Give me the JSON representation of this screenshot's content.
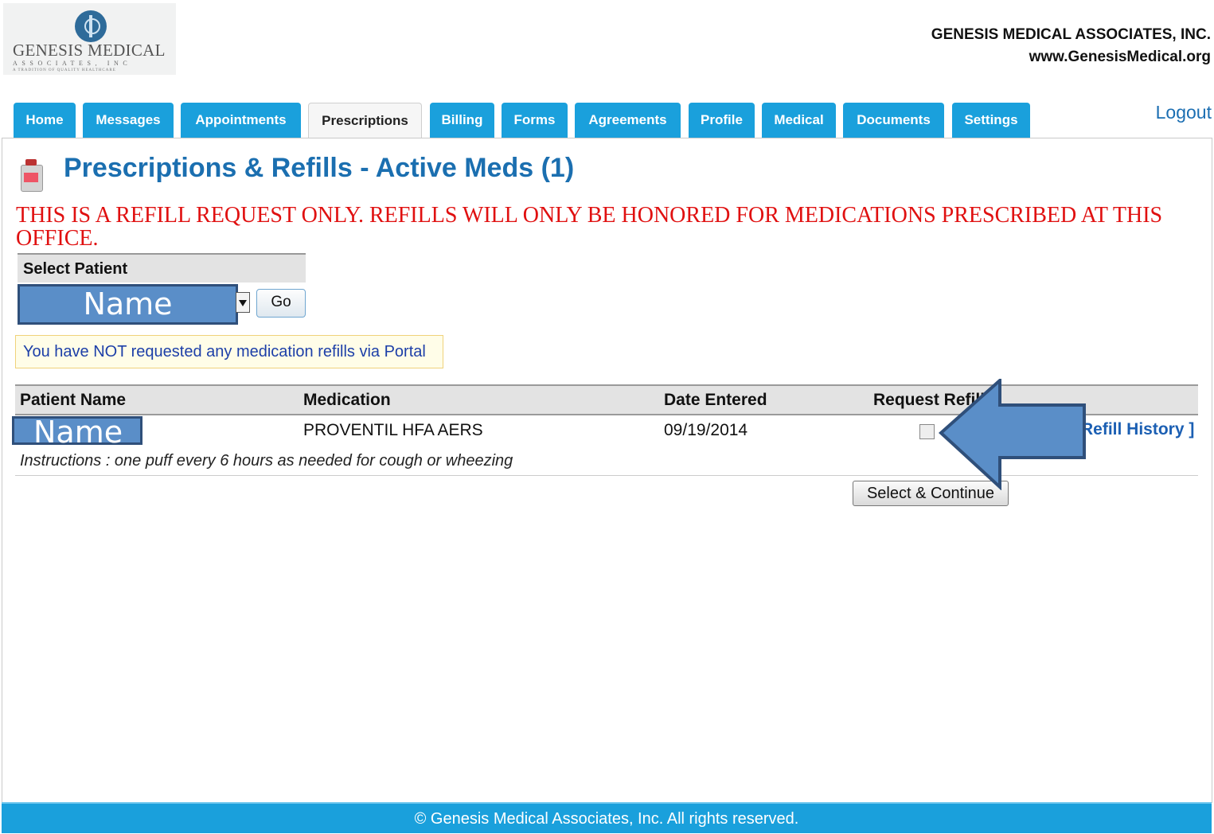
{
  "header": {
    "logo_text_1": "GENESIS MEDICAL",
    "logo_text_2": "ASSOCIATES, INC",
    "logo_text_3": "A TRADITION OF QUALITY HEALTHCARE",
    "company_name": "GENESIS MEDICAL ASSOCIATES, INC.",
    "website": "www.GenesisMedical.org"
  },
  "nav": {
    "tabs": [
      "Home",
      "Messages",
      "Appointments",
      "Prescriptions",
      "Billing",
      "Forms",
      "Agreements",
      "Profile",
      "Medical",
      "Documents",
      "Settings"
    ],
    "active_tab": "Prescriptions",
    "logout": "Logout"
  },
  "page": {
    "title": "Prescriptions & Refills - Active Meds (1)",
    "notice": "THIS IS A REFILL REQUEST ONLY.  REFILLS WILL ONLY BE HONORED FOR MEDICATIONS PRESCRIBED AT THIS OFFICE."
  },
  "patient_select": {
    "header": "Select Patient",
    "selected": "Name",
    "go_label": "Go"
  },
  "info_message": "You have NOT requested any medication refills via Portal",
  "table": {
    "headers": [
      "Patient Name",
      "Medication",
      "Date Entered",
      "Request Refill"
    ],
    "rows": [
      {
        "patient_name": "Name",
        "medication": "PROVENTIL HFA AERS",
        "date_entered": "09/19/2014",
        "request_refill": false,
        "history_link": "Refill History ]",
        "instructions": "Instructions : one puff every 6 hours as needed for cough or wheezing"
      }
    ]
  },
  "continue_label": "Select & Continue",
  "footer": "© Genesis Medical Associates, Inc. All rights reserved.",
  "colors": {
    "tab_blue": "#1aa0dc",
    "title_blue": "#1b6fb0",
    "notice_red": "#e01010",
    "overlay_blue": "#5a8ec8"
  }
}
